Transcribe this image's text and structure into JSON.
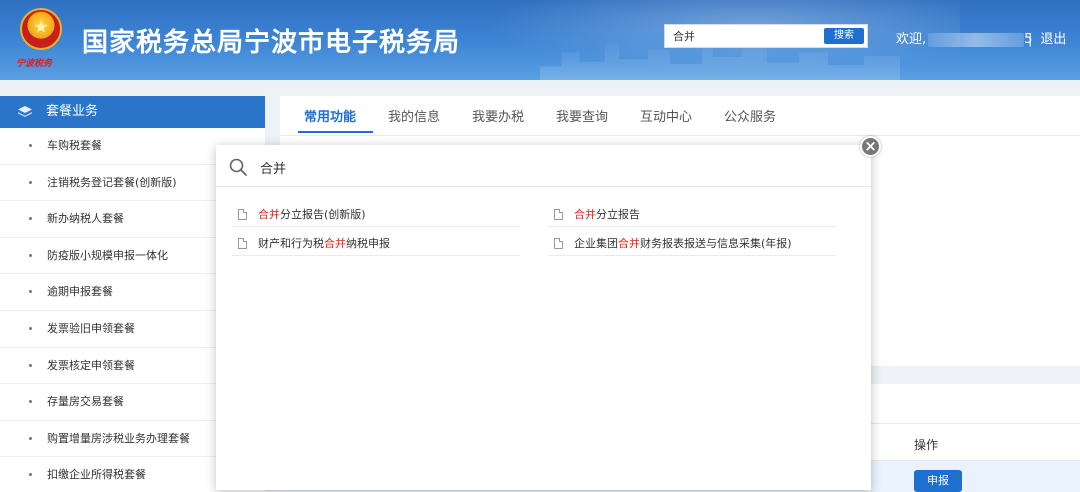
{
  "header": {
    "site_title": "国家税务总局宁波市电子税务局",
    "seal_text": "宁波税务",
    "search_value": "合并",
    "search_button": "搜索",
    "welcome_label": "欢迎,",
    "welcome_suffix": "5",
    "separator": "|",
    "logout": "退出"
  },
  "sidebar": {
    "title": "套餐业务",
    "items": [
      {
        "label": "车购税套餐"
      },
      {
        "label": "注销税务登记套餐(创新版)"
      },
      {
        "label": "新办纳税人套餐"
      },
      {
        "label": "防疫版小规模申报一体化"
      },
      {
        "label": "逾期申报套餐"
      },
      {
        "label": "发票验旧申领套餐"
      },
      {
        "label": "发票核定申领套餐"
      },
      {
        "label": "存量房交易套餐"
      },
      {
        "label": "购置增量房涉税业务办理套餐"
      },
      {
        "label": "扣缴企业所得税套餐"
      }
    ]
  },
  "main": {
    "tabs": [
      {
        "label": "常用功能"
      },
      {
        "label": "我的信息"
      },
      {
        "label": "我要办税"
      },
      {
        "label": "我要查询"
      },
      {
        "label": "互动中心"
      },
      {
        "label": "公众服务"
      }
    ],
    "operation_header": "操作",
    "declare_button": "申报"
  },
  "modal": {
    "search_value": "合并",
    "close_symbol": "×",
    "results": [
      {
        "highlight": "合并",
        "rest": "分立报告(创新版)",
        "pre": ""
      },
      {
        "highlight": "合并",
        "rest": "分立报告",
        "pre": ""
      },
      {
        "pre": "财产和行为税",
        "highlight": "合并",
        "rest": "纳税申报"
      },
      {
        "pre": "企业集团",
        "highlight": "合并",
        "rest": "财务报表报送与信息采集(年报)"
      }
    ]
  },
  "colors": {
    "header_blue": "#3f86d6",
    "accent_blue": "#1f6fd0",
    "highlight_red": "#e2231a"
  }
}
